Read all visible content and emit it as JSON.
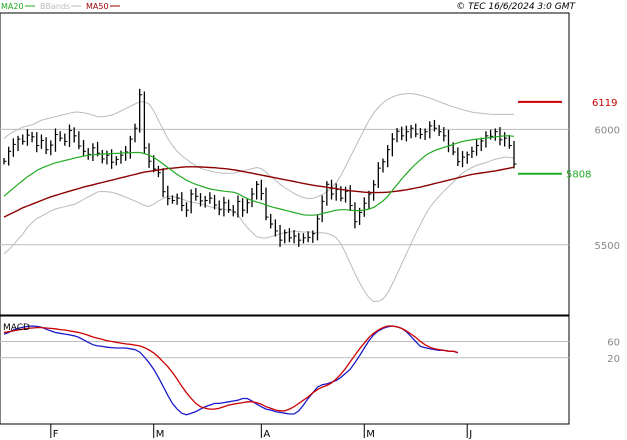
{
  "legend": [
    {
      "label": "MA20",
      "color": "#22aa22"
    },
    {
      "label": "BBands",
      "color": "#bbbbbb"
    },
    {
      "label": "MA50",
      "color": "#990000"
    }
  ],
  "copyright": "© TEC 16/6/2024 3:0 GMT",
  "colors": {
    "price": "#000000",
    "ma20": "#22aa22",
    "ma50": "#8b0000",
    "bbands": "#bbbbbb",
    "macd": "#1a1acc",
    "signal": "#cc0000",
    "grid": "#bbbbbb",
    "axis": "#000000"
  },
  "chart_data": {
    "type": "line",
    "price_panel": {
      "ylim": [
        5200,
        6500
      ],
      "y_ticks": [
        {
          "value": 6000,
          "label": "6000"
        },
        {
          "value": 5500,
          "label": "5500"
        }
      ],
      "series": {
        "close": [
          5862,
          5905,
          5935,
          5958,
          5948,
          5975,
          5968,
          5930,
          5952,
          5912,
          5932,
          5978,
          5962,
          5948,
          5995,
          5972,
          5928,
          5905,
          5892,
          5920,
          5897,
          5872,
          5888,
          5858,
          5870,
          5888,
          5902,
          5958,
          6005,
          6150,
          5920,
          5862,
          5828,
          5812,
          5730,
          5700,
          5692,
          5702,
          5670,
          5650,
          5720,
          5710,
          5690,
          5692,
          5702,
          5672,
          5652,
          5682,
          5652,
          5642,
          5688,
          5650,
          5682,
          5720,
          5762,
          5722,
          5620,
          5590,
          5560,
          5520,
          5552,
          5530,
          5538,
          5520,
          5530,
          5532,
          5548,
          5612,
          5688,
          5762,
          5720,
          5740,
          5702,
          5732,
          5670,
          5600,
          5640,
          5680,
          5720,
          5760,
          5832,
          5860,
          5912,
          5958,
          5992,
          5972,
          5990,
          6005,
          5980,
          5978,
          5990,
          6015,
          6005,
          5990,
          5972,
          5930,
          5902,
          5860,
          5880,
          5890,
          5905,
          5930,
          5950,
          5972,
          5970,
          5990,
          5955,
          5962,
          5930,
          5850
        ],
        "ma20": [
          5710,
          5728,
          5745,
          5762,
          5778,
          5795,
          5808,
          5822,
          5832,
          5840,
          5848,
          5855,
          5860,
          5865,
          5870,
          5875,
          5880,
          5884,
          5888,
          5890,
          5892,
          5893,
          5894,
          5895,
          5896,
          5897,
          5898,
          5899,
          5900,
          5900,
          5895,
          5888,
          5878,
          5865,
          5850,
          5835,
          5820,
          5805,
          5792,
          5780,
          5770,
          5762,
          5755,
          5748,
          5742,
          5738,
          5735,
          5732,
          5730,
          5728,
          5722,
          5710,
          5700,
          5692,
          5685,
          5680,
          5672,
          5665,
          5660,
          5655,
          5650,
          5645,
          5640,
          5635,
          5630,
          5628,
          5628,
          5630,
          5635,
          5640,
          5645,
          5650,
          5652,
          5652,
          5650,
          5648,
          5648,
          5650,
          5655,
          5662,
          5675,
          5690,
          5710,
          5735,
          5760,
          5785,
          5808,
          5830,
          5850,
          5868,
          5885,
          5898,
          5908,
          5915,
          5922,
          5928,
          5935,
          5942,
          5948,
          5952,
          5955,
          5958,
          5960,
          5962,
          5965,
          5968,
          5970,
          5972,
          5972,
          5970
        ],
        "ma50": [
          5620,
          5630,
          5640,
          5650,
          5660,
          5668,
          5676,
          5684,
          5692,
          5700,
          5708,
          5714,
          5720,
          5726,
          5732,
          5738,
          5744,
          5750,
          5755,
          5760,
          5765,
          5770,
          5775,
          5780,
          5785,
          5790,
          5795,
          5800,
          5805,
          5810,
          5815,
          5818,
          5821,
          5824,
          5827,
          5830,
          5832,
          5834,
          5836,
          5838,
          5838,
          5838,
          5837,
          5836,
          5835,
          5834,
          5832,
          5830,
          5828,
          5825,
          5822,
          5818,
          5814,
          5810,
          5806,
          5802,
          5798,
          5794,
          5790,
          5786,
          5782,
          5778,
          5774,
          5770,
          5766,
          5762,
          5758,
          5755,
          5752,
          5749,
          5746,
          5743,
          5740,
          5737,
          5734,
          5732,
          5730,
          5728,
          5727,
          5726,
          5726,
          5727,
          5728,
          5730,
          5732,
          5735,
          5738,
          5742,
          5746,
          5750,
          5755,
          5760,
          5765,
          5770,
          5775,
          5780,
          5785,
          5790,
          5795,
          5800,
          5805,
          5808,
          5811,
          5814,
          5817,
          5820,
          5824,
          5828,
          5832,
          5836
        ],
        "bb_upper": [
          5960,
          5978,
          5990,
          6000,
          6010,
          6015,
          6020,
          6030,
          6040,
          6045,
          6050,
          6055,
          6060,
          6065,
          6070,
          6075,
          6075,
          6072,
          6068,
          6062,
          6055,
          6055,
          6058,
          6062,
          6070,
          6080,
          6090,
          6100,
          6110,
          6120,
          6120,
          6110,
          6080,
          6040,
          6000,
          5960,
          5930,
          5905,
          5885,
          5870,
          5855,
          5842,
          5832,
          5825,
          5820,
          5815,
          5812,
          5810,
          5810,
          5810,
          5815,
          5820,
          5825,
          5830,
          5835,
          5830,
          5815,
          5795,
          5780,
          5762,
          5748,
          5735,
          5722,
          5712,
          5705,
          5700,
          5702,
          5708,
          5718,
          5730,
          5748,
          5770,
          5800,
          5840,
          5880,
          5920,
          5960,
          6000,
          6040,
          6070,
          6095,
          6115,
          6130,
          6140,
          6148,
          6152,
          6155,
          6155,
          6152,
          6148,
          6142,
          6135,
          6128,
          6120,
          6112,
          6105,
          6098,
          6092,
          6085,
          6080,
          6075,
          6072,
          6070,
          6068,
          6066,
          6065,
          6065,
          6065,
          6065,
          6065
        ],
        "bb_lower": [
          5460,
          5478,
          5500,
          5524,
          5546,
          5575,
          5596,
          5614,
          5624,
          5635,
          5646,
          5655,
          5660,
          5665,
          5670,
          5675,
          5685,
          5696,
          5708,
          5718,
          5729,
          5731,
          5730,
          5728,
          5722,
          5714,
          5706,
          5698,
          5690,
          5680,
          5670,
          5666,
          5676,
          5690,
          5700,
          5710,
          5710,
          5705,
          5699,
          5690,
          5685,
          5682,
          5678,
          5671,
          5664,
          5661,
          5658,
          5654,
          5650,
          5646,
          5629,
          5600,
          5575,
          5554,
          5535,
          5530,
          5529,
          5535,
          5540,
          5548,
          5552,
          5555,
          5558,
          5558,
          5555,
          5556,
          5554,
          5552,
          5552,
          5550,
          5542,
          5530,
          5504,
          5464,
          5420,
          5376,
          5336,
          5300,
          5270,
          5254,
          5255,
          5265,
          5290,
          5330,
          5372,
          5418,
          5461,
          5505,
          5548,
          5588,
          5628,
          5661,
          5688,
          5710,
          5732,
          5751,
          5772,
          5792,
          5811,
          5824,
          5835,
          5844,
          5850,
          5856,
          5864,
          5871,
          5875,
          5879,
          5879,
          5875
        ]
      },
      "annotations": [
        {
          "label": "6119",
          "value": 6119,
          "color": "#cc0000"
        },
        {
          "label": "5808",
          "value": 5808,
          "color": "#22aa22"
        }
      ]
    },
    "macd_panel": {
      "title": "MACD",
      "ylim": [
        -140,
        120
      ],
      "y_ticks": [
        {
          "value": 60,
          "label": "60"
        },
        {
          "value": 20,
          "label": "20"
        }
      ],
      "series": {
        "macd": [
          78,
          82,
          88,
          92,
          95,
          97,
          98,
          97,
          95,
          90,
          86,
          82,
          80,
          78,
          76,
          74,
          70,
          64,
          58,
          52,
          49,
          48,
          46,
          45,
          44,
          44,
          44,
          42,
          40,
          34,
          22,
          8,
          -8,
          -28,
          -50,
          -72,
          -92,
          -106,
          -116,
          -120,
          -116,
          -112,
          -106,
          -100,
          -96,
          -92,
          -92,
          -90,
          -88,
          -86,
          -84,
          -80,
          -80,
          -86,
          -94,
          -100,
          -106,
          -108,
          -112,
          -114,
          -116,
          -118,
          -118,
          -110,
          -96,
          -80,
          -66,
          -52,
          -46,
          -44,
          -40,
          -36,
          -28,
          -18,
          -8,
          8,
          25,
          44,
          62,
          76,
          86,
          92,
          96,
          98,
          96,
          92,
          84,
          72,
          60,
          48,
          45,
          42,
          40,
          38,
          38,
          36,
          36,
          32
        ],
        "signal": [
          82,
          84,
          86,
          88,
          90,
          92,
          93,
          94,
          94,
          93,
          92,
          91,
          89,
          88,
          86,
          84,
          82,
          79,
          75,
          71,
          68,
          65,
          62,
          60,
          58,
          56,
          54,
          53,
          51,
          49,
          45,
          39,
          32,
          22,
          10,
          -2,
          -16,
          -32,
          -50,
          -66,
          -80,
          -92,
          -100,
          -104,
          -106,
          -106,
          -104,
          -100,
          -96,
          -94,
          -92,
          -90,
          -88,
          -88,
          -90,
          -94,
          -100,
          -104,
          -108,
          -110,
          -110,
          -106,
          -100,
          -92,
          -84,
          -76,
          -66,
          -58,
          -52,
          -48,
          -42,
          -32,
          -20,
          -6,
          10,
          26,
          42,
          56,
          70,
          80,
          88,
          94,
          98,
          98,
          96,
          92,
          86,
          78,
          70,
          60,
          52,
          46,
          42,
          40,
          38,
          36,
          36,
          33
        ]
      }
    },
    "x_axis": {
      "ticks": [
        {
          "label": "F",
          "index": 10
        },
        {
          "label": "M",
          "index": 32
        },
        {
          "label": "A",
          "index": 55
        },
        {
          "label": "M",
          "index": 77
        },
        {
          "label": "J",
          "index": 99
        }
      ]
    }
  }
}
